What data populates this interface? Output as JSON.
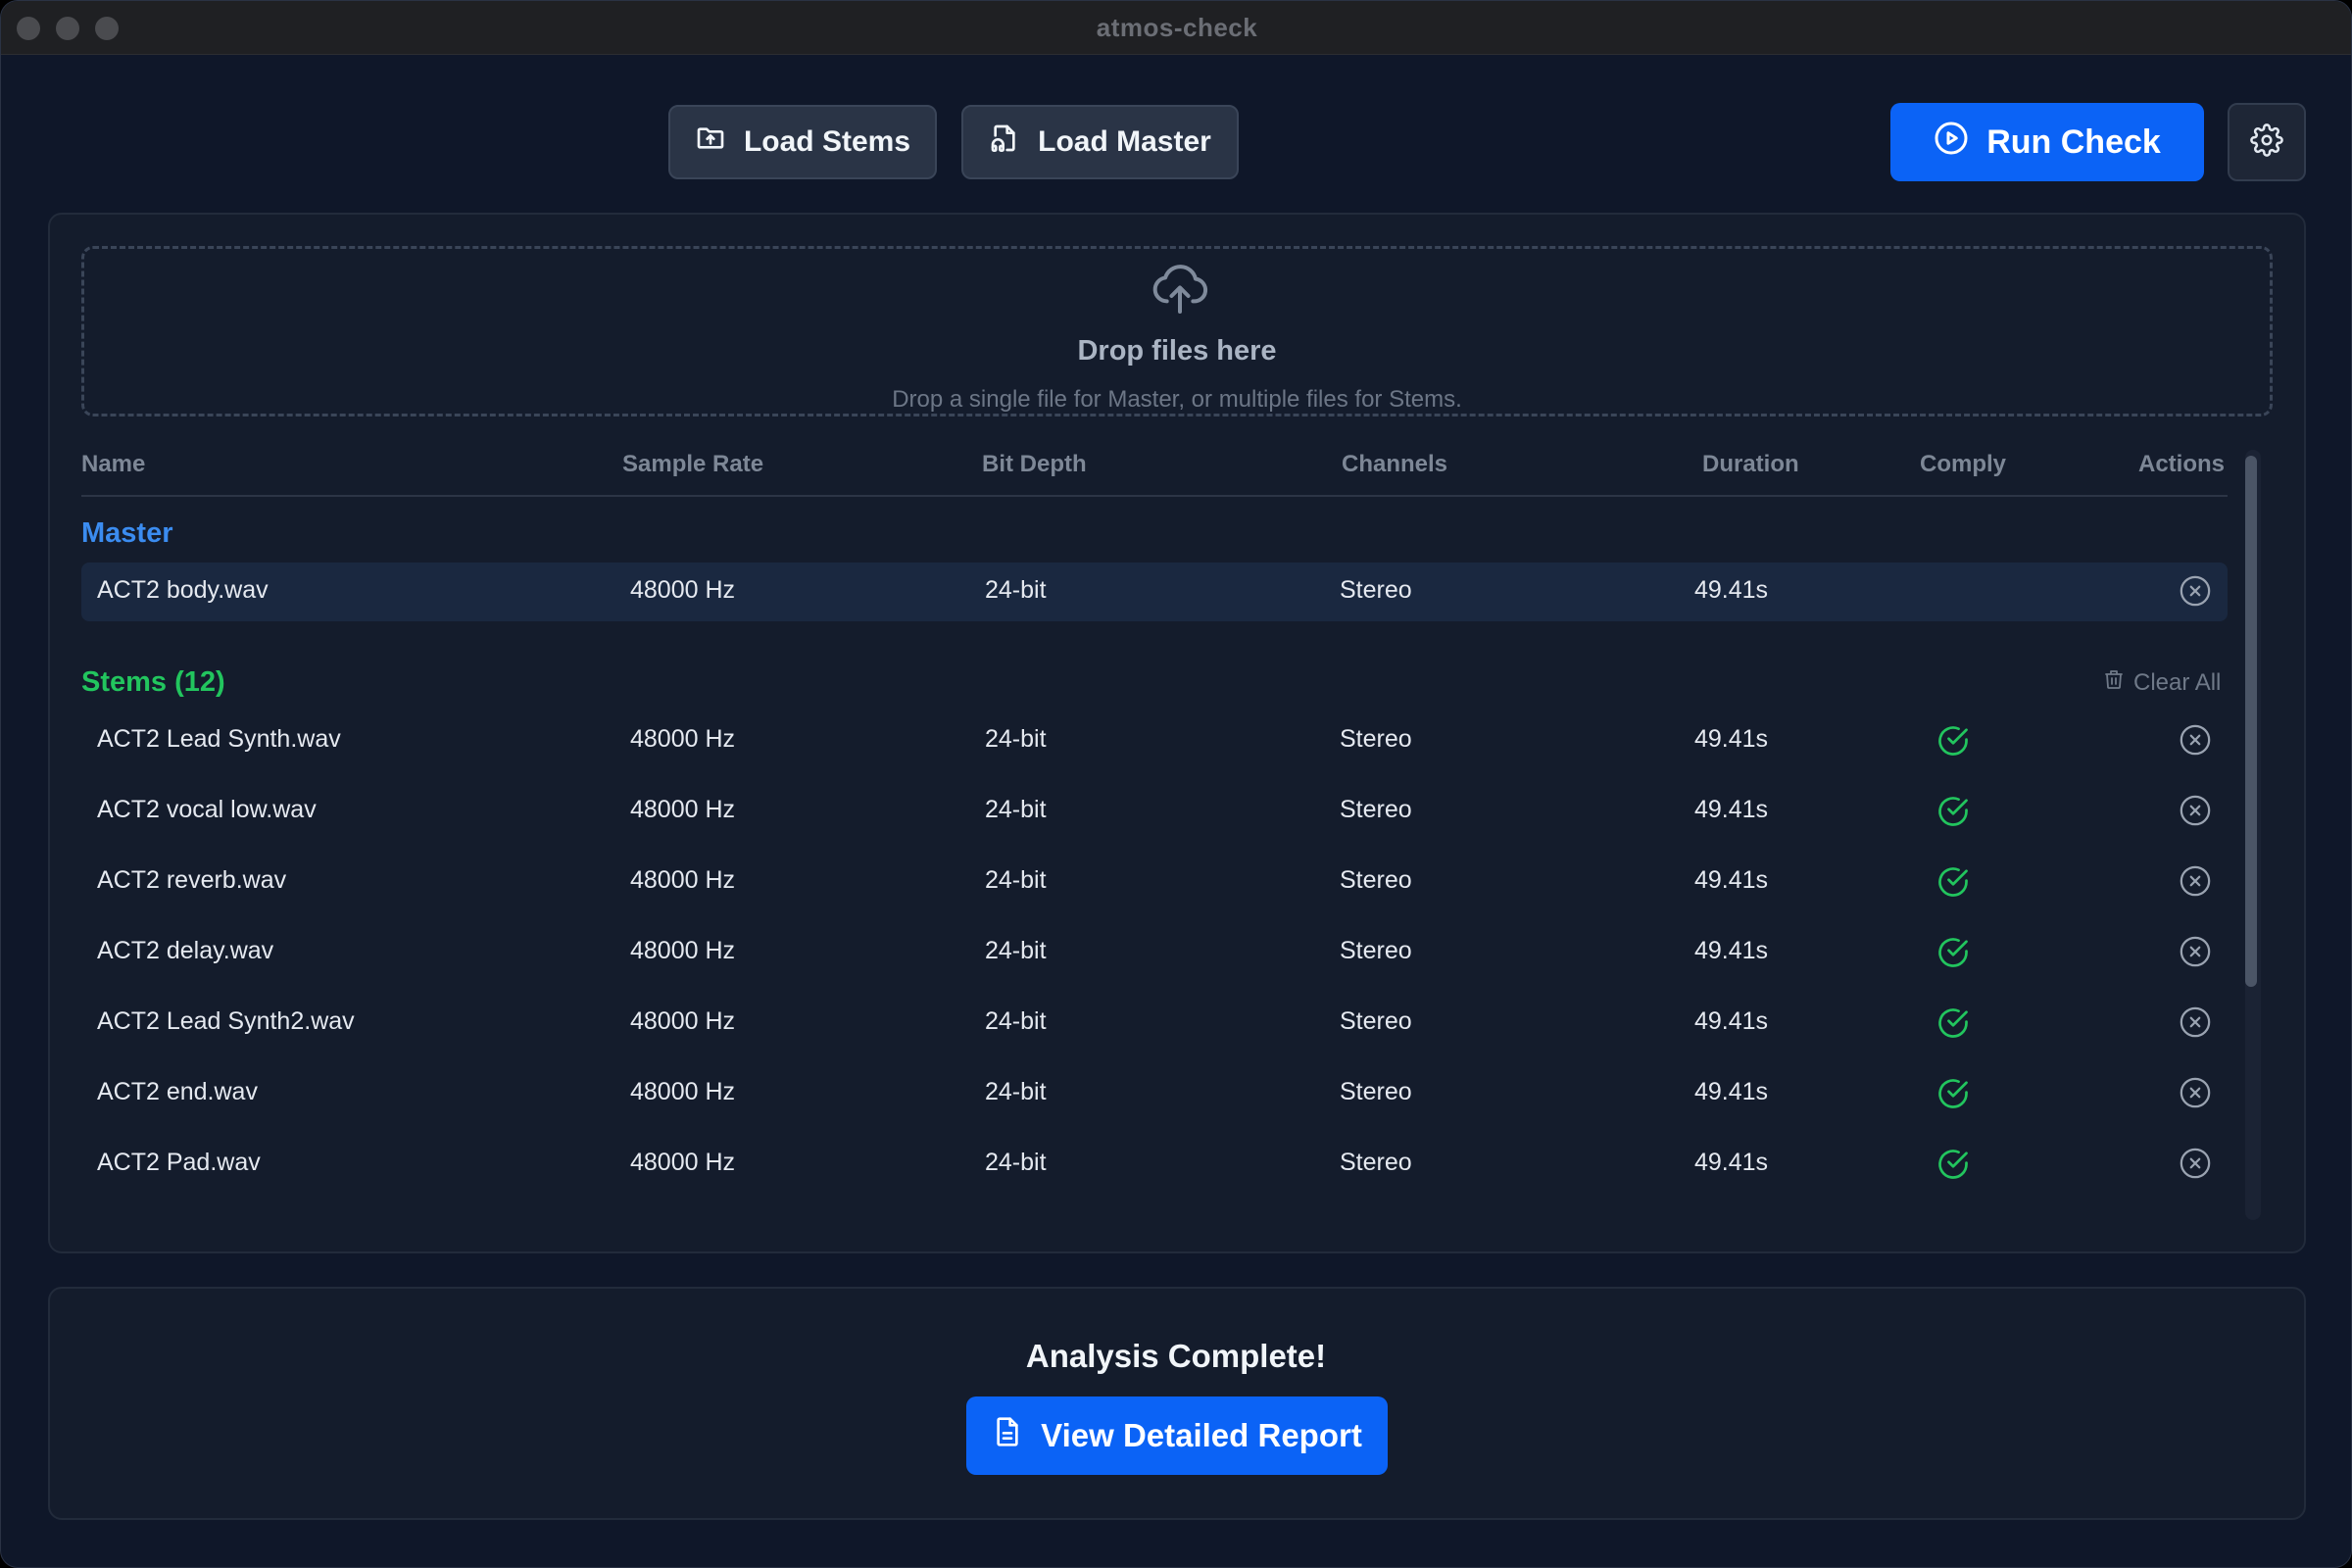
{
  "window": {
    "title": "atmos-check"
  },
  "toolbar": {
    "load_stems": "Load Stems",
    "load_master": "Load Master",
    "run_check": "Run Check"
  },
  "dropzone": {
    "title": "Drop files here",
    "subtitle": "Drop a single file for Master, or multiple files for Stems."
  },
  "table": {
    "headers": [
      "Name",
      "Sample Rate",
      "Bit Depth",
      "Channels",
      "Duration",
      "Comply",
      "Actions"
    ]
  },
  "master": {
    "label": "Master",
    "row": {
      "name": "ACT2 body.wav",
      "sample_rate": "48000 Hz",
      "bit_depth": "24-bit",
      "channels": "Stereo",
      "duration": "49.41s"
    }
  },
  "stems": {
    "label": "Stems (12)",
    "clear_all": "Clear All",
    "rows": [
      {
        "name": "ACT2 Lead Synth.wav",
        "sample_rate": "48000 Hz",
        "bit_depth": "24-bit",
        "channels": "Stereo",
        "duration": "49.41s",
        "comply": true
      },
      {
        "name": "ACT2 vocal low.wav",
        "sample_rate": "48000 Hz",
        "bit_depth": "24-bit",
        "channels": "Stereo",
        "duration": "49.41s",
        "comply": true
      },
      {
        "name": "ACT2 reverb.wav",
        "sample_rate": "48000 Hz",
        "bit_depth": "24-bit",
        "channels": "Stereo",
        "duration": "49.41s",
        "comply": true
      },
      {
        "name": "ACT2 delay.wav",
        "sample_rate": "48000 Hz",
        "bit_depth": "24-bit",
        "channels": "Stereo",
        "duration": "49.41s",
        "comply": true
      },
      {
        "name": "ACT2 Lead Synth2.wav",
        "sample_rate": "48000 Hz",
        "bit_depth": "24-bit",
        "channels": "Stereo",
        "duration": "49.41s",
        "comply": true
      },
      {
        "name": "ACT2 end.wav",
        "sample_rate": "48000 Hz",
        "bit_depth": "24-bit",
        "channels": "Stereo",
        "duration": "49.41s",
        "comply": true
      },
      {
        "name": "ACT2 Pad.wav",
        "sample_rate": "48000 Hz",
        "bit_depth": "24-bit",
        "channels": "Stereo",
        "duration": "49.41s",
        "comply": true
      }
    ]
  },
  "analysis": {
    "title": "Analysis Complete!",
    "report_button": "View Detailed Report"
  },
  "colors": {
    "accent": "#0b63f6",
    "master_label": "#3b8cf0",
    "stems_label": "#22c55e",
    "comply_ok": "#22c55e"
  },
  "icons": [
    "folder-upload-icon",
    "file-audio-icon",
    "play-circle-icon",
    "gear-icon",
    "cloud-upload-icon",
    "check-circle-icon",
    "close-circle-icon",
    "trash-icon",
    "document-icon"
  ]
}
